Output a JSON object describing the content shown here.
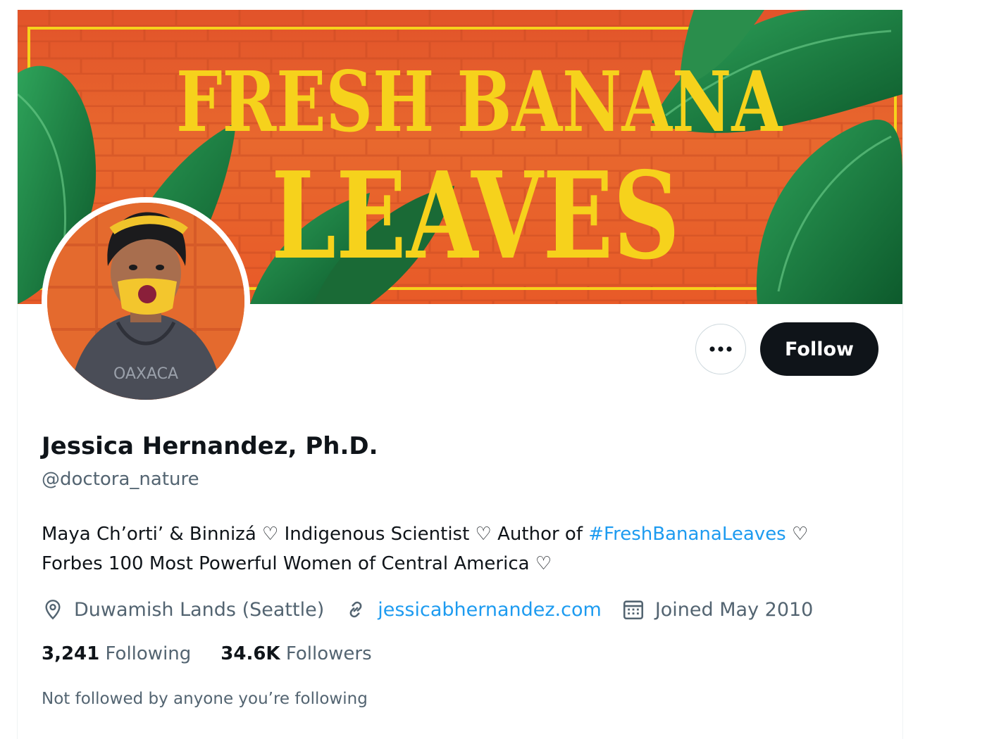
{
  "banner": {
    "title_line1": "FRESH BANANA",
    "title_line2": "LEAVES"
  },
  "avatar": {
    "hoodie_text": "OAXACA"
  },
  "actions": {
    "more_icon": "ellipsis-icon",
    "follow_label": "Follow"
  },
  "profile": {
    "name": "Jessica Hernandez, Ph.D.",
    "handle": "@doctora_nature",
    "bio": {
      "line1_a": "Maya Ch’orti’ & Binnizá ♡ Indigenous Scientist ♡ Author of ",
      "hashtag": "#FreshBananaLeaves",
      "line1_b": " ♡",
      "line2": "Forbes 100 Most Powerful Women of Central America ♡"
    },
    "location": "Duwamish Lands (Seattle)",
    "website": "jessicabhernandez.com",
    "joined": "Joined May 2010",
    "following_count": "3,241",
    "following_label": "Following",
    "followers_count": "34.6K",
    "followers_label": "Followers",
    "followed_by_note": "Not followed by anyone you’re following"
  },
  "colors": {
    "accent": "#1d9bf0",
    "text_primary": "#0f1419",
    "text_secondary": "#536471",
    "banner_orange": "#e8622d",
    "banner_yellow": "#f6d21c",
    "leaf_green": "#1f7a3e"
  },
  "icons": [
    "location-pin-icon",
    "link-icon",
    "calendar-icon",
    "ellipsis-icon"
  ]
}
